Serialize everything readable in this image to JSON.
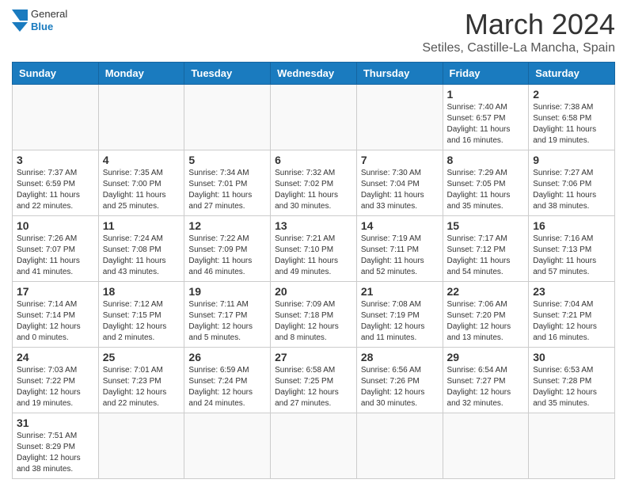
{
  "header": {
    "logo_general": "General",
    "logo_blue": "Blue",
    "month_title": "March 2024",
    "location": "Setiles, Castille-La Mancha, Spain"
  },
  "weekdays": [
    "Sunday",
    "Monday",
    "Tuesday",
    "Wednesday",
    "Thursday",
    "Friday",
    "Saturday"
  ],
  "weeks": [
    [
      {
        "day": "",
        "info": ""
      },
      {
        "day": "",
        "info": ""
      },
      {
        "day": "",
        "info": ""
      },
      {
        "day": "",
        "info": ""
      },
      {
        "day": "",
        "info": ""
      },
      {
        "day": "1",
        "info": "Sunrise: 7:40 AM\nSunset: 6:57 PM\nDaylight: 11 hours and 16 minutes."
      },
      {
        "day": "2",
        "info": "Sunrise: 7:38 AM\nSunset: 6:58 PM\nDaylight: 11 hours and 19 minutes."
      }
    ],
    [
      {
        "day": "3",
        "info": "Sunrise: 7:37 AM\nSunset: 6:59 PM\nDaylight: 11 hours and 22 minutes."
      },
      {
        "day": "4",
        "info": "Sunrise: 7:35 AM\nSunset: 7:00 PM\nDaylight: 11 hours and 25 minutes."
      },
      {
        "day": "5",
        "info": "Sunrise: 7:34 AM\nSunset: 7:01 PM\nDaylight: 11 hours and 27 minutes."
      },
      {
        "day": "6",
        "info": "Sunrise: 7:32 AM\nSunset: 7:02 PM\nDaylight: 11 hours and 30 minutes."
      },
      {
        "day": "7",
        "info": "Sunrise: 7:30 AM\nSunset: 7:04 PM\nDaylight: 11 hours and 33 minutes."
      },
      {
        "day": "8",
        "info": "Sunrise: 7:29 AM\nSunset: 7:05 PM\nDaylight: 11 hours and 35 minutes."
      },
      {
        "day": "9",
        "info": "Sunrise: 7:27 AM\nSunset: 7:06 PM\nDaylight: 11 hours and 38 minutes."
      }
    ],
    [
      {
        "day": "10",
        "info": "Sunrise: 7:26 AM\nSunset: 7:07 PM\nDaylight: 11 hours and 41 minutes."
      },
      {
        "day": "11",
        "info": "Sunrise: 7:24 AM\nSunset: 7:08 PM\nDaylight: 11 hours and 43 minutes."
      },
      {
        "day": "12",
        "info": "Sunrise: 7:22 AM\nSunset: 7:09 PM\nDaylight: 11 hours and 46 minutes."
      },
      {
        "day": "13",
        "info": "Sunrise: 7:21 AM\nSunset: 7:10 PM\nDaylight: 11 hours and 49 minutes."
      },
      {
        "day": "14",
        "info": "Sunrise: 7:19 AM\nSunset: 7:11 PM\nDaylight: 11 hours and 52 minutes."
      },
      {
        "day": "15",
        "info": "Sunrise: 7:17 AM\nSunset: 7:12 PM\nDaylight: 11 hours and 54 minutes."
      },
      {
        "day": "16",
        "info": "Sunrise: 7:16 AM\nSunset: 7:13 PM\nDaylight: 11 hours and 57 minutes."
      }
    ],
    [
      {
        "day": "17",
        "info": "Sunrise: 7:14 AM\nSunset: 7:14 PM\nDaylight: 12 hours and 0 minutes."
      },
      {
        "day": "18",
        "info": "Sunrise: 7:12 AM\nSunset: 7:15 PM\nDaylight: 12 hours and 2 minutes."
      },
      {
        "day": "19",
        "info": "Sunrise: 7:11 AM\nSunset: 7:17 PM\nDaylight: 12 hours and 5 minutes."
      },
      {
        "day": "20",
        "info": "Sunrise: 7:09 AM\nSunset: 7:18 PM\nDaylight: 12 hours and 8 minutes."
      },
      {
        "day": "21",
        "info": "Sunrise: 7:08 AM\nSunset: 7:19 PM\nDaylight: 12 hours and 11 minutes."
      },
      {
        "day": "22",
        "info": "Sunrise: 7:06 AM\nSunset: 7:20 PM\nDaylight: 12 hours and 13 minutes."
      },
      {
        "day": "23",
        "info": "Sunrise: 7:04 AM\nSunset: 7:21 PM\nDaylight: 12 hours and 16 minutes."
      }
    ],
    [
      {
        "day": "24",
        "info": "Sunrise: 7:03 AM\nSunset: 7:22 PM\nDaylight: 12 hours and 19 minutes."
      },
      {
        "day": "25",
        "info": "Sunrise: 7:01 AM\nSunset: 7:23 PM\nDaylight: 12 hours and 22 minutes."
      },
      {
        "day": "26",
        "info": "Sunrise: 6:59 AM\nSunset: 7:24 PM\nDaylight: 12 hours and 24 minutes."
      },
      {
        "day": "27",
        "info": "Sunrise: 6:58 AM\nSunset: 7:25 PM\nDaylight: 12 hours and 27 minutes."
      },
      {
        "day": "28",
        "info": "Sunrise: 6:56 AM\nSunset: 7:26 PM\nDaylight: 12 hours and 30 minutes."
      },
      {
        "day": "29",
        "info": "Sunrise: 6:54 AM\nSunset: 7:27 PM\nDaylight: 12 hours and 32 minutes."
      },
      {
        "day": "30",
        "info": "Sunrise: 6:53 AM\nSunset: 7:28 PM\nDaylight: 12 hours and 35 minutes."
      }
    ],
    [
      {
        "day": "31",
        "info": "Sunrise: 7:51 AM\nSunset: 8:29 PM\nDaylight: 12 hours and 38 minutes."
      },
      {
        "day": "",
        "info": ""
      },
      {
        "day": "",
        "info": ""
      },
      {
        "day": "",
        "info": ""
      },
      {
        "day": "",
        "info": ""
      },
      {
        "day": "",
        "info": ""
      },
      {
        "day": "",
        "info": ""
      }
    ]
  ]
}
